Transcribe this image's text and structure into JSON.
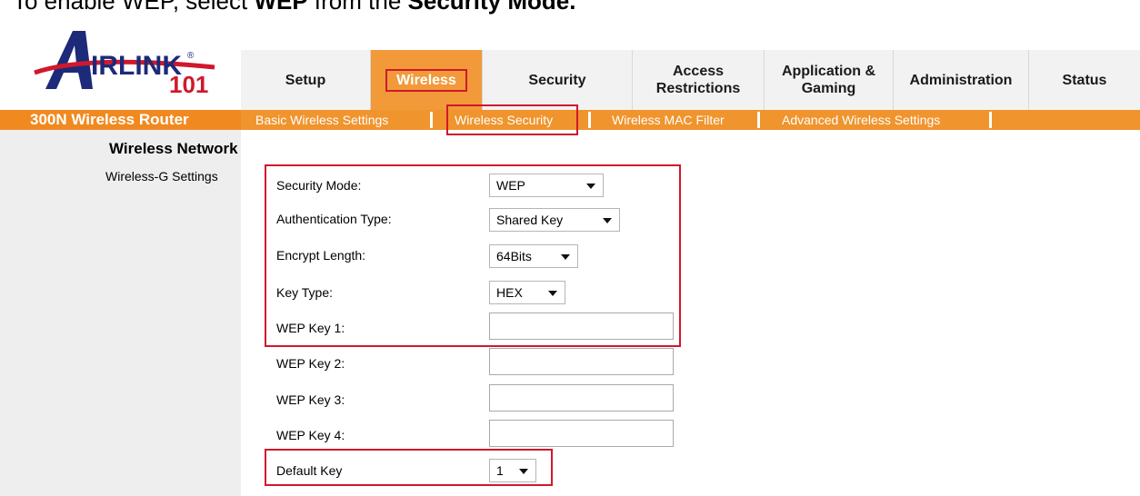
{
  "instruction": {
    "prefix": "To enable WEP, select ",
    "highlight": "WEP",
    "middle": " from the ",
    "highlight2": "Security Mode."
  },
  "logo": {
    "brand": "AIRLINK",
    "number": "101",
    "registered": "®"
  },
  "topnav": {
    "tabs": [
      {
        "label": "Setup"
      },
      {
        "label": "Wireless",
        "active": true
      },
      {
        "label": "Security"
      },
      {
        "line1": "Access",
        "line2": "Restrictions"
      },
      {
        "line1": "Application &",
        "line2": "Gaming"
      },
      {
        "label": "Administration"
      },
      {
        "label": "Status"
      }
    ]
  },
  "subbar": {
    "product": "300N Wireless Router",
    "links": [
      "Basic Wireless Settings",
      "Wireless Security",
      "Wireless MAC Filter",
      "Advanced Wireless Settings"
    ],
    "active_index": 1
  },
  "sidebar": {
    "title": "Wireless Network",
    "item": "Wireless-G Settings"
  },
  "form": {
    "security_mode": {
      "label": "Security Mode:",
      "value": "WEP"
    },
    "auth_type": {
      "label": "Authentication Type:",
      "value": "Shared Key"
    },
    "encrypt_length": {
      "label": "Encrypt Length:",
      "value": "64Bits"
    },
    "key_type": {
      "label": "Key Type:",
      "value": "HEX"
    },
    "wep_key1": {
      "label": "WEP Key 1:",
      "value": ""
    },
    "wep_key2": {
      "label": "WEP Key 2:",
      "value": ""
    },
    "wep_key3": {
      "label": "WEP Key 3:",
      "value": ""
    },
    "wep_key4": {
      "label": "WEP Key 4:",
      "value": ""
    },
    "default_key": {
      "label": "Default Key",
      "value": "1"
    }
  },
  "colors": {
    "accent": "#f0942d",
    "highlight_box": "#d0182c",
    "nav_bg": "#f2f2f2",
    "sidebar_bg": "#eeeeee"
  }
}
